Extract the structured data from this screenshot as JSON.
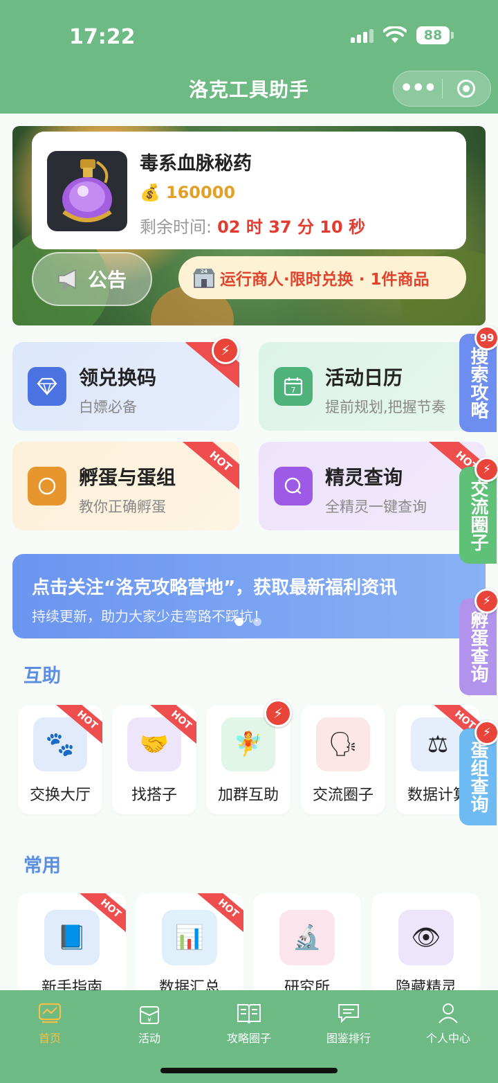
{
  "status": {
    "time": "17:22",
    "battery": "88"
  },
  "nav": {
    "title": "洛克工具助手"
  },
  "prize": {
    "name": "毒系血脉秘药",
    "price": "160000",
    "timer_label": "剩余时间:",
    "timer_value": "02 时 37 分 10 秒"
  },
  "notice": {
    "label": "公告"
  },
  "merchant": {
    "text": "运行商人·限时兑换 · 1件商品"
  },
  "features": [
    {
      "title": "领兑换码",
      "subtitle": "白嫖必备"
    },
    {
      "title": "活动日历",
      "subtitle": "提前规划,把握节奏"
    },
    {
      "title": "孵蛋与蛋组",
      "subtitle": "教你正确孵蛋",
      "badge": "HOT"
    },
    {
      "title": "精灵查询",
      "subtitle": "全精灵一键查询",
      "badge": "HOT"
    }
  ],
  "promo": {
    "title": "点击关注“洛克攻略营地”，获取最新福利资讯",
    "subtitle": "持续更新，助力大家少走弯路不踩坑！"
  },
  "mutual": {
    "title": "互助",
    "items": [
      {
        "label": "交换大厅",
        "badge": "HOT"
      },
      {
        "label": "找搭子",
        "badge": "HOT"
      },
      {
        "label": "加群互助"
      },
      {
        "label": "交流圈子"
      },
      {
        "label": "数据计算",
        "badge": "HOT"
      }
    ]
  },
  "common": {
    "title": "常用",
    "items": [
      {
        "label": "新手指南",
        "badge": "HOT"
      },
      {
        "label": "数据汇总",
        "badge": "HOT"
      },
      {
        "label": "研究所"
      },
      {
        "label": "隐藏精灵"
      }
    ]
  },
  "side_tabs": [
    {
      "label": "搜索攻略",
      "badge": "99"
    },
    {
      "label": "交流圈子"
    },
    {
      "label": "孵蛋查询"
    },
    {
      "label": "蛋组查询"
    }
  ],
  "tabs": [
    {
      "label": "首页"
    },
    {
      "label": "活动"
    },
    {
      "label": "攻略圈子"
    },
    {
      "label": "图鉴排行"
    },
    {
      "label": "个人中心"
    }
  ],
  "colors": {
    "header": "#6dba85",
    "accent_red": "#e23b2f",
    "active_tab": "#f5c04a"
  }
}
